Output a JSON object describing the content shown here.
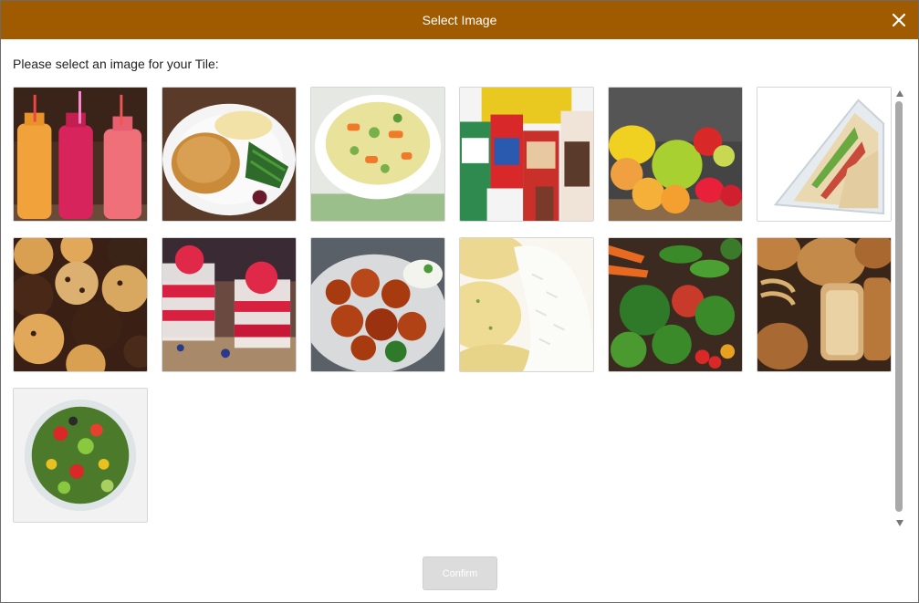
{
  "dialog": {
    "title": "Select Image",
    "close_icon": "close-icon",
    "prompt": "Please select an image for your Tile:",
    "confirm_label": "Confirm"
  },
  "images": [
    {
      "name": "juice-bottles"
    },
    {
      "name": "chicken-cutlet-plate"
    },
    {
      "name": "vegetable-soup"
    },
    {
      "name": "snack-packages"
    },
    {
      "name": "fresh-fruit"
    },
    {
      "name": "sandwich-container"
    },
    {
      "name": "muffins"
    },
    {
      "name": "raspberry-parfait"
    },
    {
      "name": "glazed-chicken"
    },
    {
      "name": "potatoes-and-rice"
    },
    {
      "name": "vegetable-assortment"
    },
    {
      "name": "bread-loaves"
    },
    {
      "name": "salad-bowl"
    }
  ],
  "colors": {
    "titlebar": "#a05a00",
    "confirm_disabled": "#dcdcdc"
  }
}
